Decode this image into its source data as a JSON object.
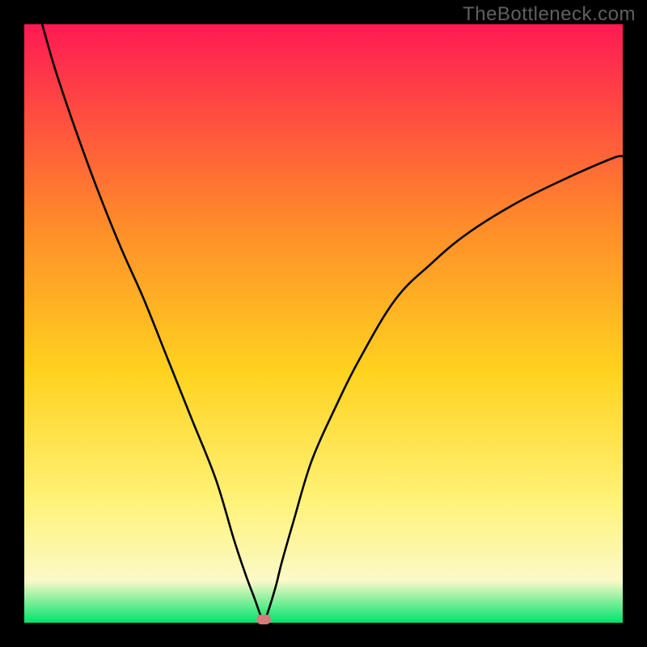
{
  "watermark": "TheBottleneck.com",
  "colors": {
    "frame": "#000000",
    "gradient_top": "#ff1a53",
    "gradient_upper_mid": "#ff8a2a",
    "gradient_mid": "#ffd21f",
    "gradient_lower_mid": "#fff37a",
    "gradient_pale": "#fbf9c8",
    "gradient_bottom": "#00e36b",
    "curve": "#000000",
    "marker": "#d97a7a"
  },
  "chart_data": {
    "type": "line",
    "title": "",
    "xlabel": "",
    "ylabel": "",
    "xlim": [
      0,
      100
    ],
    "ylim": [
      0,
      100
    ],
    "series": [
      {
        "name": "bottleneck-curve",
        "x": [
          3,
          5,
          8,
          12,
          16,
          20,
          24,
          28,
          32,
          35,
          37,
          38.5,
          39.5,
          40,
          40.5,
          42,
          43,
          45,
          48,
          52,
          56,
          62,
          68,
          74,
          82,
          90,
          98,
          100
        ],
        "values": [
          100,
          93,
          84,
          73,
          63,
          54,
          44,
          34,
          24,
          14,
          8,
          4,
          1.2,
          0.5,
          1.2,
          6,
          10,
          17,
          27,
          36,
          44,
          54,
          60,
          65,
          70,
          74,
          77.5,
          78
        ]
      }
    ],
    "marker": {
      "x": 40,
      "y": 0.5
    },
    "annotations": []
  }
}
